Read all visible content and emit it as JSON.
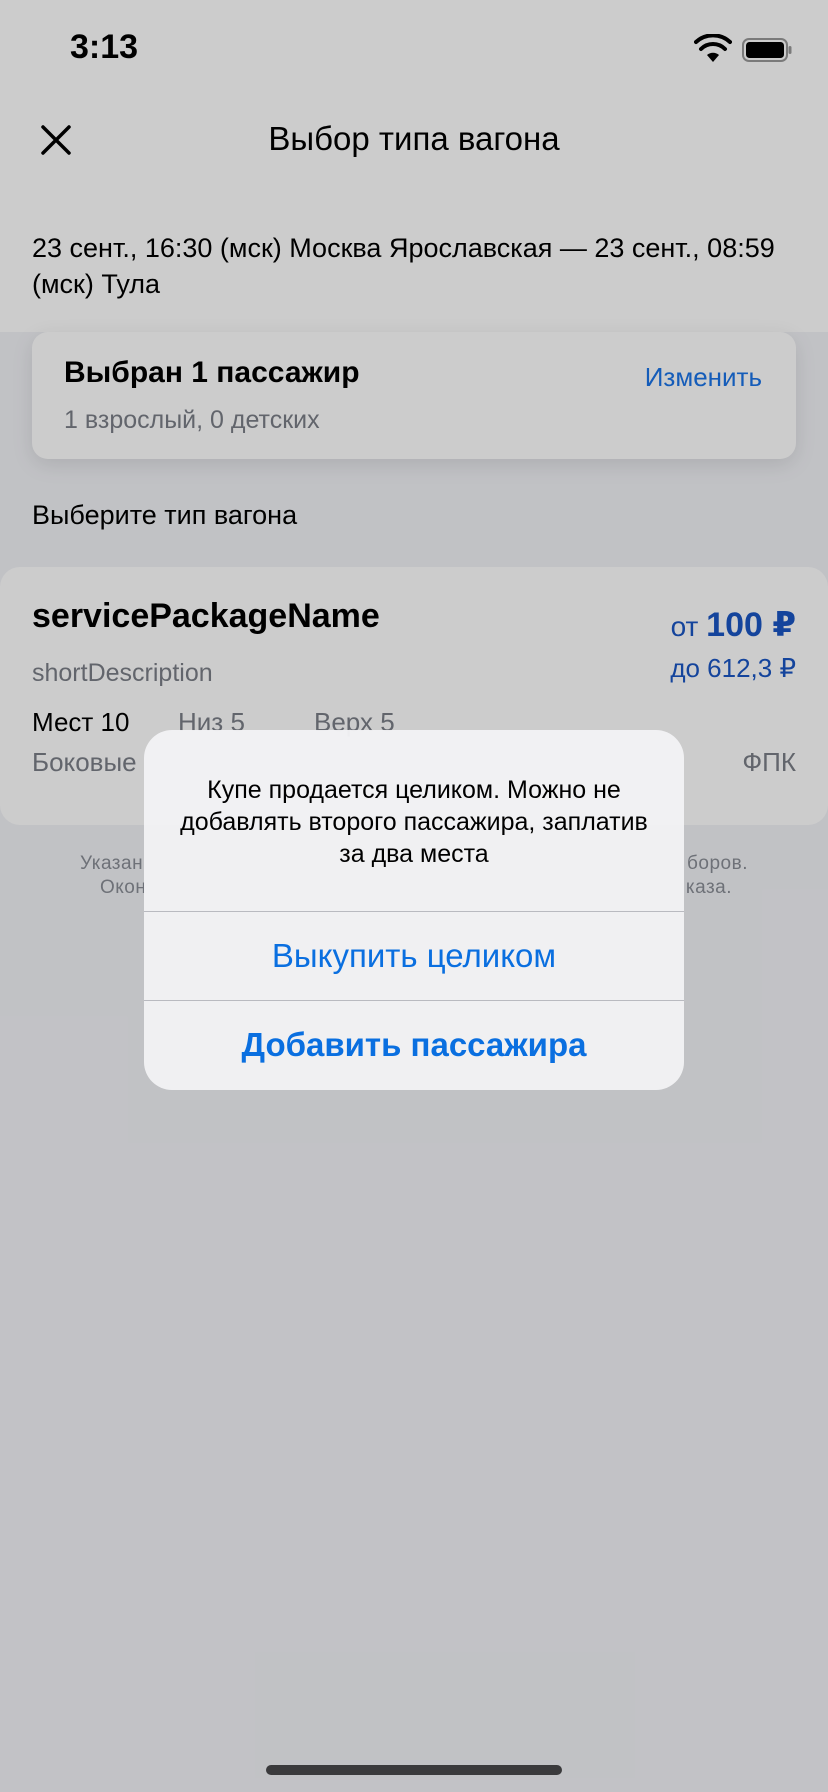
{
  "status_bar": {
    "time": "3:13"
  },
  "nav": {
    "title": "Выбор типа вагона"
  },
  "route": {
    "text": "23 сент., 16:30 (мск) Москва Ярославская — 23 сент., 08:59 (мск) Тула"
  },
  "passengers": {
    "title": "Выбран 1 пассажир",
    "subtitle": "1 взрослый, 0 детских",
    "change_label": "Изменить"
  },
  "choose_label": "Выберите тип вагона",
  "wagon": {
    "name": "servicePackageName",
    "description": "shortDescription",
    "price_from_prefix": "от",
    "price_from": "100 ₽",
    "price_to": "до 612,3 ₽",
    "seats": "Мест 10",
    "lower": "Низ 5",
    "upper": "Верх 5",
    "side": "Боковые",
    "carrier": "ФПК"
  },
  "footnote": {
    "line1_start": "Указан",
    "line1_end": "боров.",
    "line2_start": "Окон",
    "line2_end": "каза."
  },
  "alert": {
    "message": "Купе продается целиком. Можно не добавлять второго пассажира, заплатив за два места",
    "primary_action": "Выкупить целиком",
    "secondary_action": "Добавить пассажира"
  },
  "colors": {
    "accent": "#1a73e8",
    "alert_button": "#0a6fe0"
  }
}
